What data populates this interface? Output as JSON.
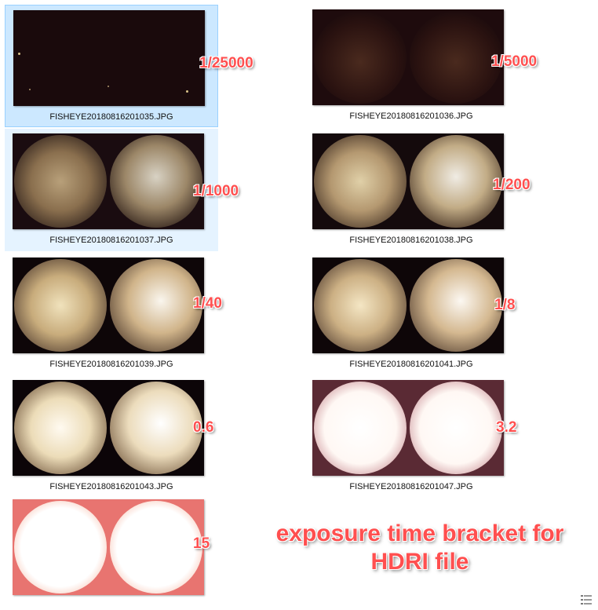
{
  "files": [
    {
      "name": "FISHEYE20180816201035.JPG",
      "exposure": "1/25000",
      "state": "selected",
      "brightness": 0.05
    },
    {
      "name": "FISHEYE20180816201036.JPG",
      "exposure": "1/5000",
      "state": "normal",
      "brightness": 0.15
    },
    {
      "name": "FISHEYE20180816201037.JPG",
      "exposure": "1/1000",
      "state": "hover",
      "brightness": 0.45
    },
    {
      "name": "FISHEYE20180816201038.JPG",
      "exposure": "1/200",
      "state": "normal",
      "brightness": 0.6
    },
    {
      "name": "FISHEYE20180816201039.JPG",
      "exposure": "1/40",
      "state": "normal",
      "brightness": 0.7
    },
    {
      "name": "FISHEYE20180816201041.JPG",
      "exposure": "1/8",
      "state": "normal",
      "brightness": 0.75
    },
    {
      "name": "FISHEYE20180816201043.JPG",
      "exposure": "0.6",
      "state": "normal",
      "brightness": 0.85
    },
    {
      "name": "FISHEYE20180816201047.JPG",
      "exposure": "3.2",
      "state": "normal",
      "brightness": 0.95
    },
    {
      "name": "",
      "exposure": "15",
      "state": "normal",
      "brightness": 1.0
    }
  ],
  "caption": {
    "line1": "exposure time bracket for",
    "line2": "HDRI file"
  },
  "status_icon": "details-view-icon",
  "colors": {
    "accent_label": "#ff4f4f",
    "selected_bg": "#cce8ff",
    "hover_bg": "#e5f3ff"
  }
}
